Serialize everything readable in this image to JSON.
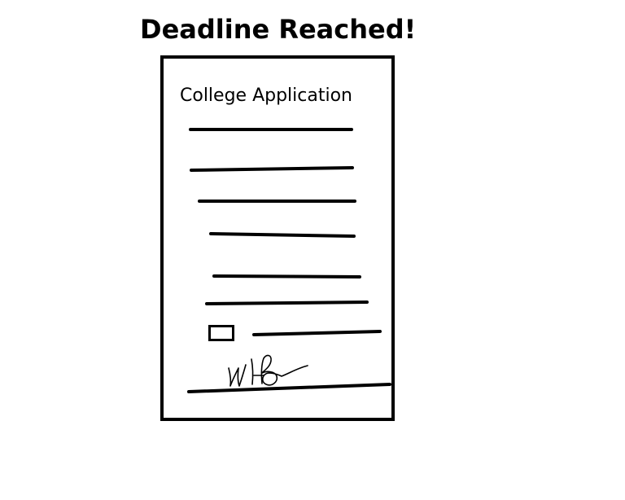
{
  "drawing": {
    "title": "Deadline Reached!",
    "document": {
      "heading": "College Application",
      "checkbox_checked": false,
      "signature_present": true
    },
    "colors": {
      "ink": "#000000",
      "paper": "#ffffff"
    }
  }
}
